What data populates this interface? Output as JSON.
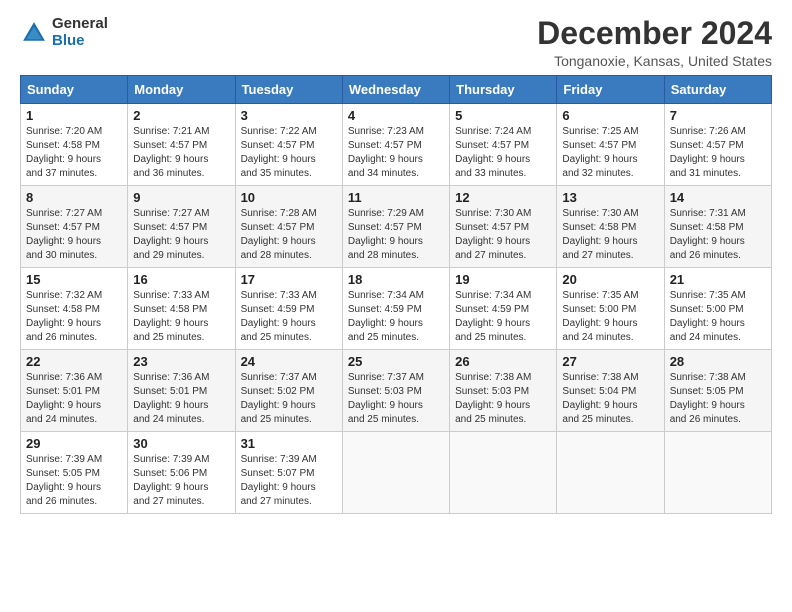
{
  "logo": {
    "line1": "General",
    "line2": "Blue"
  },
  "title": "December 2024",
  "location": "Tonganoxie, Kansas, United States",
  "headers": [
    "Sunday",
    "Monday",
    "Tuesday",
    "Wednesday",
    "Thursday",
    "Friday",
    "Saturday"
  ],
  "weeks": [
    [
      {
        "day": "1",
        "info": "Sunrise: 7:20 AM\nSunset: 4:58 PM\nDaylight: 9 hours\nand 37 minutes."
      },
      {
        "day": "2",
        "info": "Sunrise: 7:21 AM\nSunset: 4:57 PM\nDaylight: 9 hours\nand 36 minutes."
      },
      {
        "day": "3",
        "info": "Sunrise: 7:22 AM\nSunset: 4:57 PM\nDaylight: 9 hours\nand 35 minutes."
      },
      {
        "day": "4",
        "info": "Sunrise: 7:23 AM\nSunset: 4:57 PM\nDaylight: 9 hours\nand 34 minutes."
      },
      {
        "day": "5",
        "info": "Sunrise: 7:24 AM\nSunset: 4:57 PM\nDaylight: 9 hours\nand 33 minutes."
      },
      {
        "day": "6",
        "info": "Sunrise: 7:25 AM\nSunset: 4:57 PM\nDaylight: 9 hours\nand 32 minutes."
      },
      {
        "day": "7",
        "info": "Sunrise: 7:26 AM\nSunset: 4:57 PM\nDaylight: 9 hours\nand 31 minutes."
      }
    ],
    [
      {
        "day": "8",
        "info": "Sunrise: 7:27 AM\nSunset: 4:57 PM\nDaylight: 9 hours\nand 30 minutes."
      },
      {
        "day": "9",
        "info": "Sunrise: 7:27 AM\nSunset: 4:57 PM\nDaylight: 9 hours\nand 29 minutes."
      },
      {
        "day": "10",
        "info": "Sunrise: 7:28 AM\nSunset: 4:57 PM\nDaylight: 9 hours\nand 28 minutes."
      },
      {
        "day": "11",
        "info": "Sunrise: 7:29 AM\nSunset: 4:57 PM\nDaylight: 9 hours\nand 28 minutes."
      },
      {
        "day": "12",
        "info": "Sunrise: 7:30 AM\nSunset: 4:57 PM\nDaylight: 9 hours\nand 27 minutes."
      },
      {
        "day": "13",
        "info": "Sunrise: 7:30 AM\nSunset: 4:58 PM\nDaylight: 9 hours\nand 27 minutes."
      },
      {
        "day": "14",
        "info": "Sunrise: 7:31 AM\nSunset: 4:58 PM\nDaylight: 9 hours\nand 26 minutes."
      }
    ],
    [
      {
        "day": "15",
        "info": "Sunrise: 7:32 AM\nSunset: 4:58 PM\nDaylight: 9 hours\nand 26 minutes."
      },
      {
        "day": "16",
        "info": "Sunrise: 7:33 AM\nSunset: 4:58 PM\nDaylight: 9 hours\nand 25 minutes."
      },
      {
        "day": "17",
        "info": "Sunrise: 7:33 AM\nSunset: 4:59 PM\nDaylight: 9 hours\nand 25 minutes."
      },
      {
        "day": "18",
        "info": "Sunrise: 7:34 AM\nSunset: 4:59 PM\nDaylight: 9 hours\nand 25 minutes."
      },
      {
        "day": "19",
        "info": "Sunrise: 7:34 AM\nSunset: 4:59 PM\nDaylight: 9 hours\nand 25 minutes."
      },
      {
        "day": "20",
        "info": "Sunrise: 7:35 AM\nSunset: 5:00 PM\nDaylight: 9 hours\nand 24 minutes."
      },
      {
        "day": "21",
        "info": "Sunrise: 7:35 AM\nSunset: 5:00 PM\nDaylight: 9 hours\nand 24 minutes."
      }
    ],
    [
      {
        "day": "22",
        "info": "Sunrise: 7:36 AM\nSunset: 5:01 PM\nDaylight: 9 hours\nand 24 minutes."
      },
      {
        "day": "23",
        "info": "Sunrise: 7:36 AM\nSunset: 5:01 PM\nDaylight: 9 hours\nand 24 minutes."
      },
      {
        "day": "24",
        "info": "Sunrise: 7:37 AM\nSunset: 5:02 PM\nDaylight: 9 hours\nand 25 minutes."
      },
      {
        "day": "25",
        "info": "Sunrise: 7:37 AM\nSunset: 5:03 PM\nDaylight: 9 hours\nand 25 minutes."
      },
      {
        "day": "26",
        "info": "Sunrise: 7:38 AM\nSunset: 5:03 PM\nDaylight: 9 hours\nand 25 minutes."
      },
      {
        "day": "27",
        "info": "Sunrise: 7:38 AM\nSunset: 5:04 PM\nDaylight: 9 hours\nand 25 minutes."
      },
      {
        "day": "28",
        "info": "Sunrise: 7:38 AM\nSunset: 5:05 PM\nDaylight: 9 hours\nand 26 minutes."
      }
    ],
    [
      {
        "day": "29",
        "info": "Sunrise: 7:39 AM\nSunset: 5:05 PM\nDaylight: 9 hours\nand 26 minutes."
      },
      {
        "day": "30",
        "info": "Sunrise: 7:39 AM\nSunset: 5:06 PM\nDaylight: 9 hours\nand 27 minutes."
      },
      {
        "day": "31",
        "info": "Sunrise: 7:39 AM\nSunset: 5:07 PM\nDaylight: 9 hours\nand 27 minutes."
      },
      {
        "day": "",
        "info": ""
      },
      {
        "day": "",
        "info": ""
      },
      {
        "day": "",
        "info": ""
      },
      {
        "day": "",
        "info": ""
      }
    ]
  ]
}
